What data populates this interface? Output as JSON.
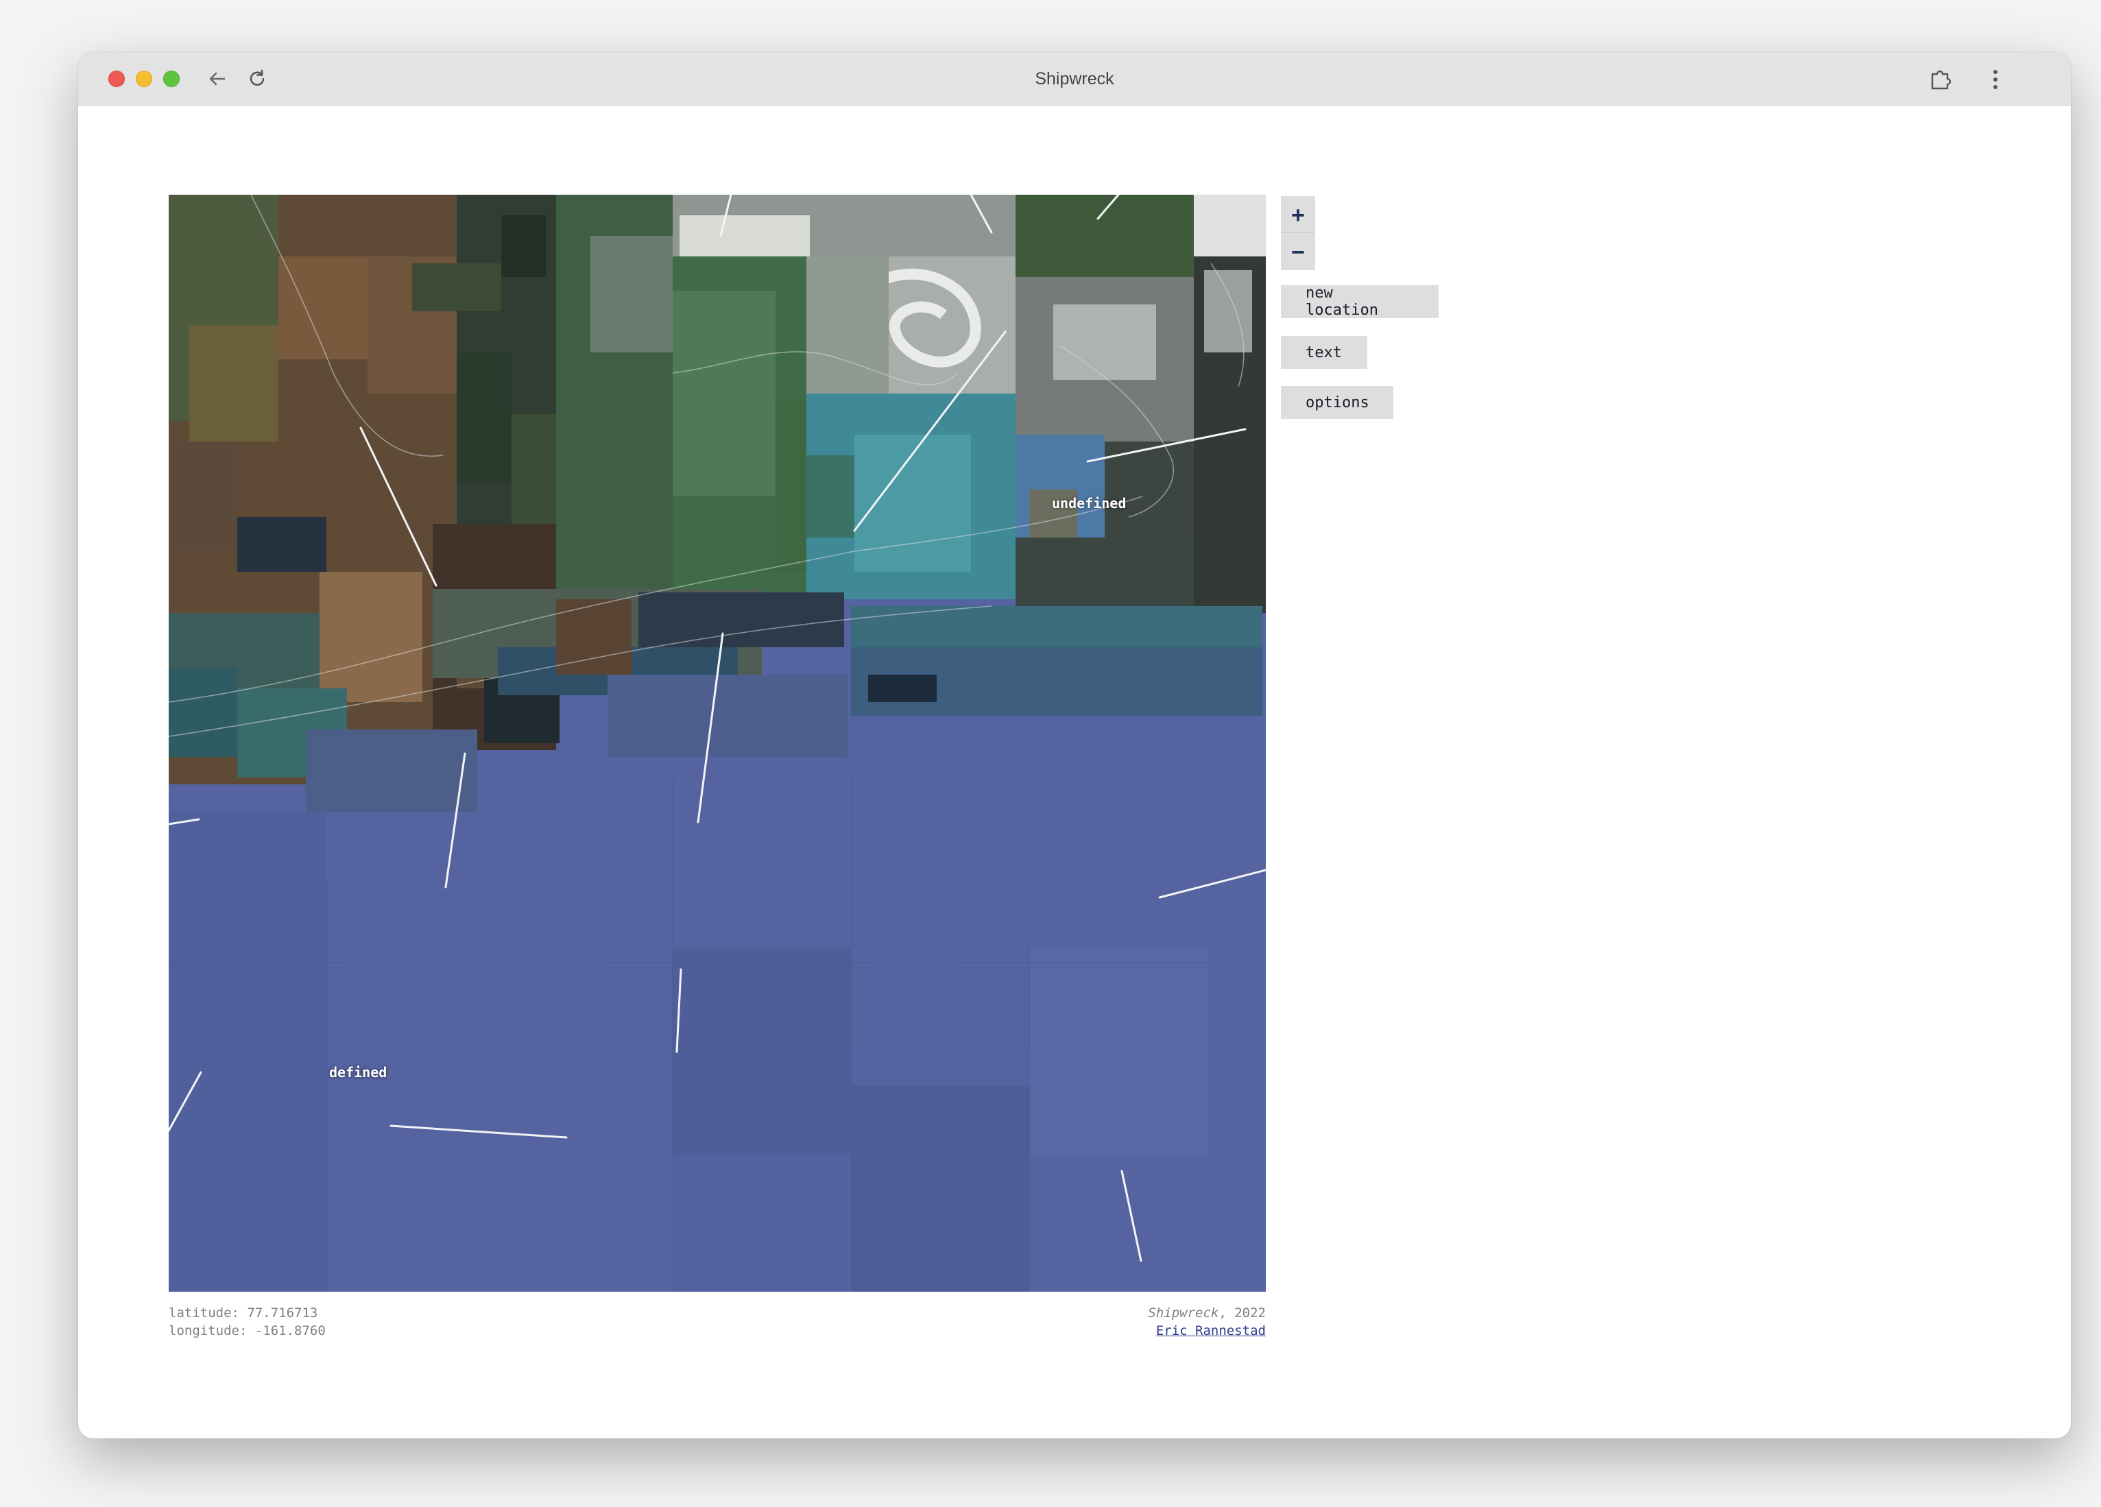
{
  "window": {
    "title": "Shipwreck"
  },
  "toolbar": {
    "icons": [
      "back-arrow-icon",
      "reload-icon",
      "extension-puzzle-icon",
      "kebab-menu-icon"
    ]
  },
  "map": {
    "labels": {
      "undefined": "undefined",
      "defined": "defined"
    },
    "colors": {
      "ocean": "#5563a0",
      "land_green": "#3f6b46",
      "land_brown": "#6e5038",
      "glacier": "#a9aeab",
      "lagoon": "#3f8a96"
    }
  },
  "controls": {
    "zoom_in": "+",
    "zoom_out": "−",
    "new_location": "new location",
    "text": "text",
    "options": "options"
  },
  "info": {
    "latitude": "latitude: 77.716713",
    "longitude": "longitude: -161.8760",
    "work_title": "Shipwreck",
    "work_year": ", 2022",
    "author": "Eric Rannestad"
  }
}
